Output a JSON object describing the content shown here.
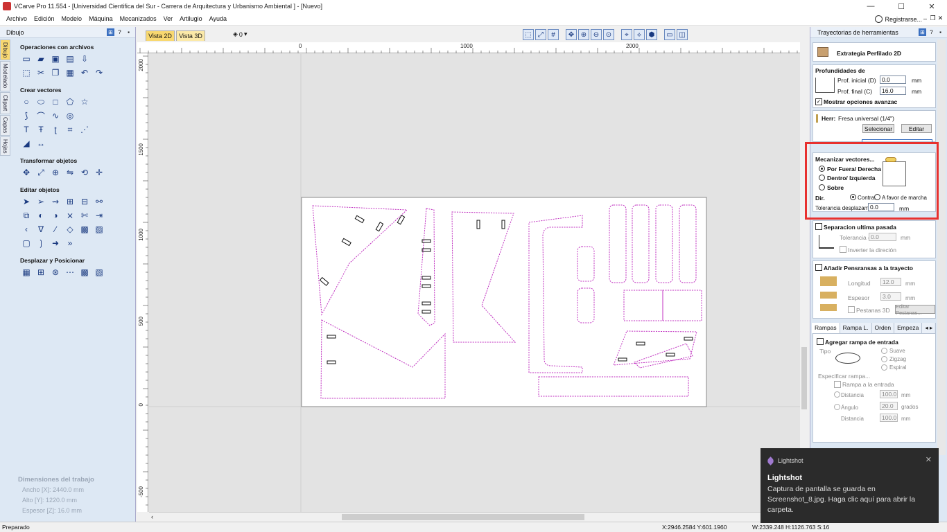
{
  "window": {
    "title": "VCarve Pro 11.554 - [Universidad Cientifica del Sur - Carrera de Arquitectura y Urbanismo Ambiental ] - [Nuevo]",
    "min": "—",
    "max": "☐",
    "close": "✕"
  },
  "menu": {
    "items": [
      "Archivo",
      "Edición",
      "Modelo",
      "Máquina",
      "Mecanizados",
      "Ver",
      "Artilugio",
      "Ayuda"
    ],
    "register": "Registrarse..."
  },
  "left_panel": {
    "title": "Dibujo",
    "vtabs": [
      "Dibujo",
      "Modelado",
      "Clipart",
      "Capas",
      "Hojas"
    ],
    "sections": [
      {
        "title": "Operaciones con archivos",
        "rows": [
          [
            "new-file-icon",
            "open-folder-icon",
            "save-icon",
            "save-as-icon",
            "import-icon"
          ],
          [
            "import-vector-icon",
            "cut-icon",
            "copy-icon",
            "paste-icon",
            "undo-icon",
            "redo-icon"
          ]
        ]
      },
      {
        "title": "Crear vectores",
        "rows": [
          [
            "circle-icon",
            "ellipse-icon",
            "rectangle-icon",
            "polygon-icon",
            "star-icon"
          ],
          [
            "polyline-icon",
            "arc-icon",
            "curve-icon",
            "spiral-icon"
          ],
          [
            "text-icon",
            "text-box-icon",
            "text-on-curve-icon",
            "dimension-icon",
            "trace-icon"
          ],
          [
            "measure-icon",
            "dimension-line-icon"
          ]
        ]
      },
      {
        "title": "Transformar objetos",
        "rows": [
          [
            "move-icon",
            "scale-icon",
            "align-icon",
            "mirror-icon",
            "rotate-icon",
            "center-icon"
          ]
        ]
      },
      {
        "title": "Editar objetos",
        "rows": [
          [
            "select-icon",
            "node-edit-icon",
            "interactive-trim-icon",
            "group-icon",
            "ungroup-icon",
            "join-icon"
          ],
          [
            "weld-icon",
            "subtract-icon",
            "intersect-icon",
            "trim-icon",
            "scissors-icon",
            "extend-icon"
          ],
          [
            "fillet-icon",
            "chamfer-icon",
            "smooth-icon",
            "offset-icon",
            "nest-icon",
            "bitmap-icon"
          ],
          [
            "round-rect-icon",
            "bracket-icon",
            "arrow-icon",
            "bracket-right-icon"
          ]
        ]
      },
      {
        "title": "Desplazar y Posicionar",
        "rows": [
          [
            "array-icon",
            "grid-array-icon",
            "circular-array-icon",
            "path-copy-icon",
            "qr-icon",
            "nest-grid-icon"
          ]
        ]
      }
    ],
    "job": {
      "title": "Dimensiones del trabajo",
      "width": "Ancho   [X]: 2440.0 mm",
      "height": "Alto    [Y]: 1220.0 mm",
      "thickness": "Espesor [Z]: 16.0 mm"
    }
  },
  "view": {
    "tab2d": "Vista 2D",
    "tab3d": "Vista 3D",
    "layer": "0",
    "toolbar_icons": [
      "zoom-box-icon",
      "zoom-fit-icon",
      "grid-icon",
      "pan-icon",
      "zoom-in-icon",
      "zoom-out-icon",
      "zoom-all-icon",
      "snap-icon",
      "toolpath-icon",
      "tool-icon",
      "layout-icon",
      "split-view-icon"
    ]
  },
  "ruler": {
    "h": [
      "0",
      "1000",
      "2000"
    ],
    "v": [
      "2000",
      "1500",
      "1000",
      "500",
      "0",
      "-500"
    ]
  },
  "right_panel": {
    "title": "Trayectorias de herramientas",
    "strategy": "Extrategia Perfilado 2D",
    "depths": {
      "title": "Profundidades de",
      "start_label": "Prof. inicial (D)",
      "start_val": "0.0",
      "end_label": "Prof. final (C)",
      "end_val": "16.0",
      "unit": "mm",
      "advanced": "Mostrar opciones avanzac"
    },
    "tool": {
      "label": "Herr:",
      "name": "Fresa universal (1/4\")",
      "select": "Selecionar",
      "edit": "Editar"
    },
    "machine": {
      "title": "Mecanizar vectores...",
      "outside": "Por Fuera/ Derecha",
      "inside": "Dentro/ Izquierda",
      "on": "Sobre",
      "dir_label": "Dir.",
      "climb": "Contram",
      "conventional": "A favor de marcha",
      "tol_label": "Tolerancia desplazami",
      "tol_val": "0.0",
      "unit": "mm"
    },
    "separation": {
      "title": "Separacion ultima pasada",
      "tol_label": "Tolerancia (A)",
      "tol_val": "0.0",
      "unit": "mm",
      "reverse": "Inverter la direción"
    },
    "tabs": {
      "title": "Añadir Pensransas a la trayecto",
      "length_label": "Longitud",
      "length_val": "12.0",
      "thick_label": "Espesor",
      "thick_val": "3.0",
      "unit": "mm",
      "tabs3d": "Pestanas 3D",
      "edit": "Editar Pestanas..."
    },
    "bottom_tabs": [
      "Rampas",
      "Rampa L.",
      "Orden",
      "Empeza"
    ],
    "ramps": {
      "title": "Agregar rampa de entrada",
      "type_label": "Tipo",
      "smooth": "Suave",
      "zigzag": "Zigzag",
      "spiral": "Espiral",
      "specify": "Especificar rampa...",
      "ramp_entry": "Rampa a la entrada",
      "distance_label": "Distancia",
      "distance_val": "100.0",
      "unit": "mm",
      "angle_label": "Ángulo",
      "angle_val": "20.0",
      "angle_unit": "grados",
      "dist2_label": "Distancia",
      "dist2_val": "100.0"
    }
  },
  "status": {
    "left": "Preparado",
    "coords": "X:2946.2584 Y:601.1960",
    "dims": "W:2339.248   H:1126.763  S:16"
  },
  "toast": {
    "app": "Lightshot",
    "title": "Lightshot",
    "body": "Captura de pantalla se guarda en Screenshot_8.jpg. Haga clic aquí para abrir la carpeta.",
    "close": "✕"
  },
  "colors": {
    "accent_tab": "#f8d870",
    "highlight": "#e8312f",
    "vectors": "#c030c0"
  }
}
